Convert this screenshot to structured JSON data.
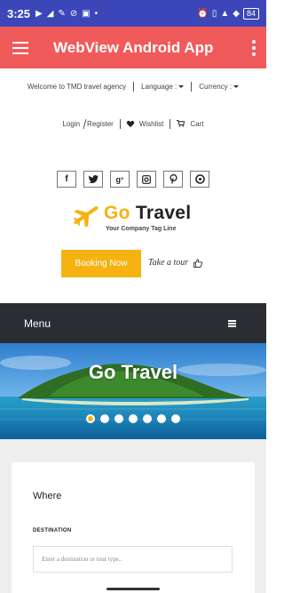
{
  "status_bar": {
    "time": "3:25",
    "battery": "84"
  },
  "app_bar": {
    "title": "WebView Android App"
  },
  "top_bar": {
    "welcome": "Welcome to TMD travel agency",
    "language": "Language :",
    "currency": "Currency :",
    "login": "Login",
    "register": "Register",
    "wishlist": "Wishlist",
    "cart": "Cart"
  },
  "social": [
    "facebook-icon",
    "twitter-icon",
    "google-plus-icon",
    "instagram-icon",
    "pinterest-icon",
    "dribbble-icon"
  ],
  "logo": {
    "go": "Go",
    "travel": "Travel",
    "tagline": "Your Company Tag Line"
  },
  "cta": {
    "booking": "Booking Now",
    "tour": "Take a tour"
  },
  "menu": {
    "label": "Menu"
  },
  "hero": {
    "title": "Go Travel",
    "slides": 7,
    "active_slide": 1
  },
  "search": {
    "heading": "Where",
    "destination_label": "DESTINATION",
    "destination_placeholder": "Enter a destination or tour type.."
  },
  "colors": {
    "status": "#3b46b8",
    "appbar": "#f15a5a",
    "accent": "#f5b211",
    "menu": "#2b2d33"
  }
}
